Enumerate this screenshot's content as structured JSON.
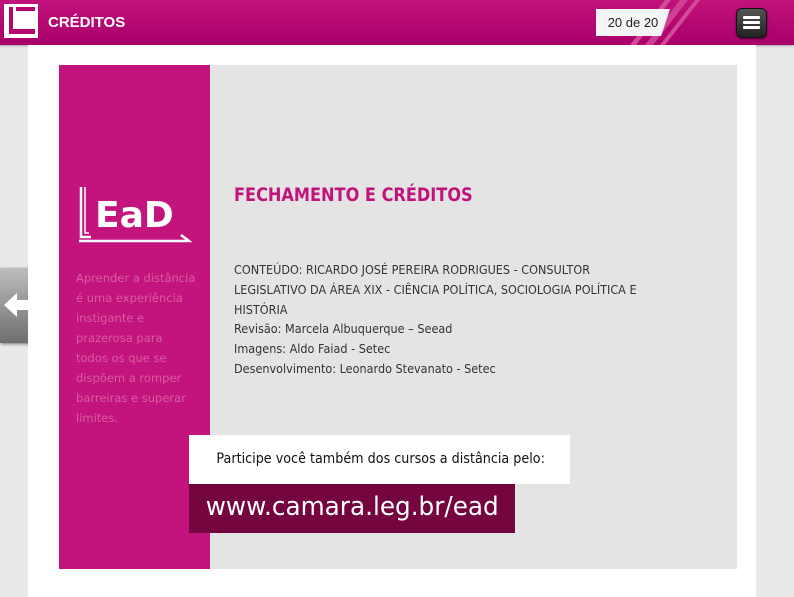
{
  "header": {
    "title": "CRÉDITOS",
    "page_counter": "20 de 20"
  },
  "sidebar": {
    "logo_text": "EaD",
    "tagline": "Aprender a distância é uma experiência instigante e prazerosa para todos os que se dispõem a romper barreiras e superar limites."
  },
  "main": {
    "heading": "FECHAMENTO E CRÉDITOS",
    "content": "CONTEÚDO: RICARDO JOSÉ PEREIRA RODRIGUES - CONSULTOR LEGISLATIVO DA ÁREA XIX - CIÊNCIA POLÍTICA, SOCIOLOGIA POLÍTICA E HISTÓRIA",
    "credits": [
      "Revisão: Marcela Albuquerque – Seead",
      "Imagens: Aldo Faiad - Setec",
      "Desenvolvimento: Leonardo Stevanato - Setec"
    ],
    "participe": "Participe você também dos cursos a distância pelo:",
    "url": "www.camara.leg.br/ead"
  },
  "colors": {
    "brand": "#c2127b",
    "url_bg": "#75053f",
    "slide_bg": "#e4e4e4"
  },
  "icons": [
    "camara-logo-icon",
    "hamburger-menu-icon",
    "back-arrow-icon"
  ]
}
